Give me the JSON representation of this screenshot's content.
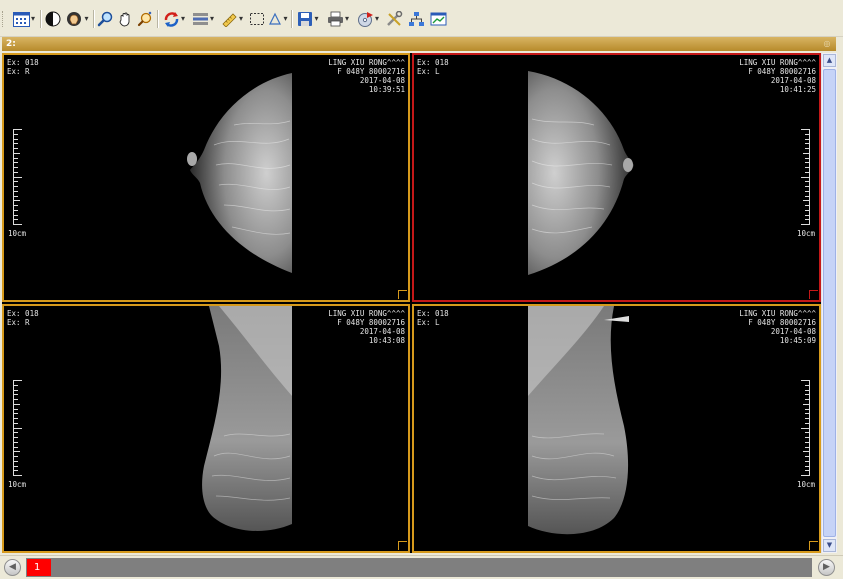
{
  "toolbar": {
    "items": [
      "layout-grid",
      "window-level",
      "hand-tools",
      "zoom",
      "pan",
      "magnify",
      "rotate",
      "stack",
      "measure-line",
      "roi-rectangle",
      "triangle",
      "save",
      "print",
      "export",
      "tools",
      "network",
      "presentation"
    ]
  },
  "series_window": {
    "title": "2:"
  },
  "viewports": [
    {
      "ex": "Ex: 018",
      "side": "Ex: R",
      "patient": "LING XIU RONG^^^^",
      "id": "F 048Y 80002716",
      "date": "2017-04-08",
      "time": "10:39:51",
      "scale": "10cm",
      "active": false
    },
    {
      "ex": "Ex: 018",
      "side": "Ex: L",
      "patient": "LING XIU RONG^^^^",
      "id": "F 048Y 80002716",
      "date": "2017-04-08",
      "time": "10:41:25",
      "scale": "10cm",
      "active": true
    },
    {
      "ex": "Ex: 018",
      "side": "Ex: R",
      "patient": "LING XIU RONG^^^^",
      "id": "F 048Y 80002716",
      "date": "2017-04-08",
      "time": "10:43:08",
      "scale": "10cm",
      "active": false
    },
    {
      "ex": "Ex: 018",
      "side": "Ex: L",
      "patient": "LING XIU RONG^^^^",
      "id": "F 048Y 80002716",
      "date": "2017-04-08",
      "time": "10:45:09",
      "scale": "10cm",
      "active": false
    }
  ],
  "pager": {
    "current_page": "1"
  },
  "colors": {
    "frame": "#d69a1c",
    "active_frame": "#c41818",
    "title_bar": "#c49a3e",
    "page_active": "#ff0000"
  }
}
